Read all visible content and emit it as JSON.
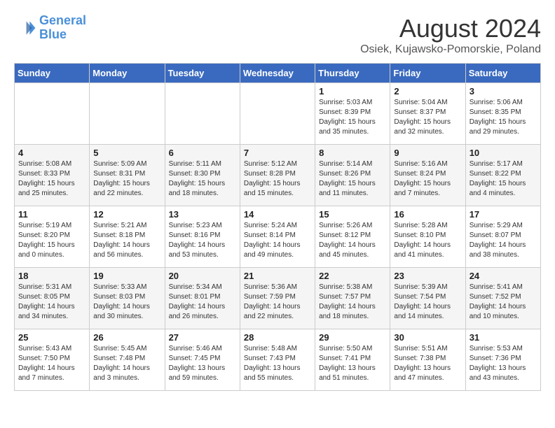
{
  "header": {
    "logo_line1": "General",
    "logo_line2": "Blue",
    "month_year": "August 2024",
    "location": "Osiek, Kujawsko-Pomorskie, Poland"
  },
  "days_of_week": [
    "Sunday",
    "Monday",
    "Tuesday",
    "Wednesday",
    "Thursday",
    "Friday",
    "Saturday"
  ],
  "weeks": [
    [
      {
        "day": "",
        "info": ""
      },
      {
        "day": "",
        "info": ""
      },
      {
        "day": "",
        "info": ""
      },
      {
        "day": "",
        "info": ""
      },
      {
        "day": "1",
        "info": "Sunrise: 5:03 AM\nSunset: 8:39 PM\nDaylight: 15 hours\nand 35 minutes."
      },
      {
        "day": "2",
        "info": "Sunrise: 5:04 AM\nSunset: 8:37 PM\nDaylight: 15 hours\nand 32 minutes."
      },
      {
        "day": "3",
        "info": "Sunrise: 5:06 AM\nSunset: 8:35 PM\nDaylight: 15 hours\nand 29 minutes."
      }
    ],
    [
      {
        "day": "4",
        "info": "Sunrise: 5:08 AM\nSunset: 8:33 PM\nDaylight: 15 hours\nand 25 minutes."
      },
      {
        "day": "5",
        "info": "Sunrise: 5:09 AM\nSunset: 8:31 PM\nDaylight: 15 hours\nand 22 minutes."
      },
      {
        "day": "6",
        "info": "Sunrise: 5:11 AM\nSunset: 8:30 PM\nDaylight: 15 hours\nand 18 minutes."
      },
      {
        "day": "7",
        "info": "Sunrise: 5:12 AM\nSunset: 8:28 PM\nDaylight: 15 hours\nand 15 minutes."
      },
      {
        "day": "8",
        "info": "Sunrise: 5:14 AM\nSunset: 8:26 PM\nDaylight: 15 hours\nand 11 minutes."
      },
      {
        "day": "9",
        "info": "Sunrise: 5:16 AM\nSunset: 8:24 PM\nDaylight: 15 hours\nand 7 minutes."
      },
      {
        "day": "10",
        "info": "Sunrise: 5:17 AM\nSunset: 8:22 PM\nDaylight: 15 hours\nand 4 minutes."
      }
    ],
    [
      {
        "day": "11",
        "info": "Sunrise: 5:19 AM\nSunset: 8:20 PM\nDaylight: 15 hours\nand 0 minutes."
      },
      {
        "day": "12",
        "info": "Sunrise: 5:21 AM\nSunset: 8:18 PM\nDaylight: 14 hours\nand 56 minutes."
      },
      {
        "day": "13",
        "info": "Sunrise: 5:23 AM\nSunset: 8:16 PM\nDaylight: 14 hours\nand 53 minutes."
      },
      {
        "day": "14",
        "info": "Sunrise: 5:24 AM\nSunset: 8:14 PM\nDaylight: 14 hours\nand 49 minutes."
      },
      {
        "day": "15",
        "info": "Sunrise: 5:26 AM\nSunset: 8:12 PM\nDaylight: 14 hours\nand 45 minutes."
      },
      {
        "day": "16",
        "info": "Sunrise: 5:28 AM\nSunset: 8:10 PM\nDaylight: 14 hours\nand 41 minutes."
      },
      {
        "day": "17",
        "info": "Sunrise: 5:29 AM\nSunset: 8:07 PM\nDaylight: 14 hours\nand 38 minutes."
      }
    ],
    [
      {
        "day": "18",
        "info": "Sunrise: 5:31 AM\nSunset: 8:05 PM\nDaylight: 14 hours\nand 34 minutes."
      },
      {
        "day": "19",
        "info": "Sunrise: 5:33 AM\nSunset: 8:03 PM\nDaylight: 14 hours\nand 30 minutes."
      },
      {
        "day": "20",
        "info": "Sunrise: 5:34 AM\nSunset: 8:01 PM\nDaylight: 14 hours\nand 26 minutes."
      },
      {
        "day": "21",
        "info": "Sunrise: 5:36 AM\nSunset: 7:59 PM\nDaylight: 14 hours\nand 22 minutes."
      },
      {
        "day": "22",
        "info": "Sunrise: 5:38 AM\nSunset: 7:57 PM\nDaylight: 14 hours\nand 18 minutes."
      },
      {
        "day": "23",
        "info": "Sunrise: 5:39 AM\nSunset: 7:54 PM\nDaylight: 14 hours\nand 14 minutes."
      },
      {
        "day": "24",
        "info": "Sunrise: 5:41 AM\nSunset: 7:52 PM\nDaylight: 14 hours\nand 10 minutes."
      }
    ],
    [
      {
        "day": "25",
        "info": "Sunrise: 5:43 AM\nSunset: 7:50 PM\nDaylight: 14 hours\nand 7 minutes."
      },
      {
        "day": "26",
        "info": "Sunrise: 5:45 AM\nSunset: 7:48 PM\nDaylight: 14 hours\nand 3 minutes."
      },
      {
        "day": "27",
        "info": "Sunrise: 5:46 AM\nSunset: 7:45 PM\nDaylight: 13 hours\nand 59 minutes."
      },
      {
        "day": "28",
        "info": "Sunrise: 5:48 AM\nSunset: 7:43 PM\nDaylight: 13 hours\nand 55 minutes."
      },
      {
        "day": "29",
        "info": "Sunrise: 5:50 AM\nSunset: 7:41 PM\nDaylight: 13 hours\nand 51 minutes."
      },
      {
        "day": "30",
        "info": "Sunrise: 5:51 AM\nSunset: 7:38 PM\nDaylight: 13 hours\nand 47 minutes."
      },
      {
        "day": "31",
        "info": "Sunrise: 5:53 AM\nSunset: 7:36 PM\nDaylight: 13 hours\nand 43 minutes."
      }
    ]
  ]
}
